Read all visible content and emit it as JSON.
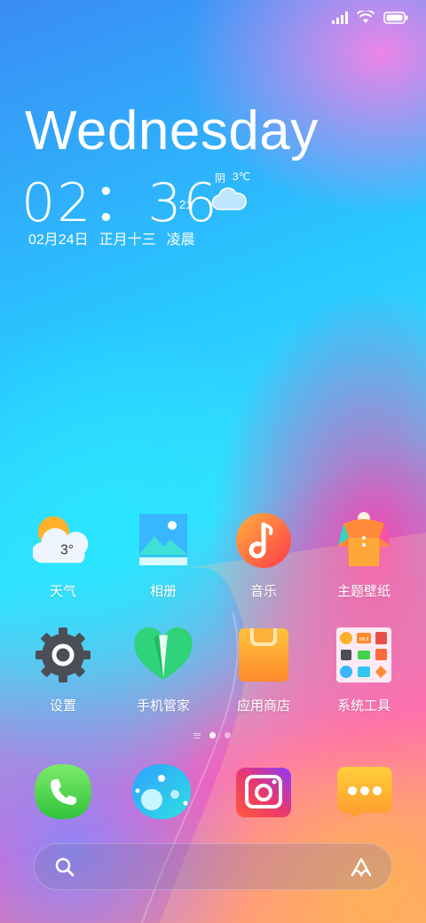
{
  "status_bar": {
    "icons": [
      "signal-icon",
      "wifi-icon",
      "battery-icon"
    ]
  },
  "clock": {
    "day": "Wednesday",
    "time": "02：36",
    "seconds": "21",
    "date": "02月24日",
    "lunar": "正月十三",
    "period": "凌晨"
  },
  "weather": {
    "condition": "阴",
    "temp": "3℃",
    "icon": "cloud-icon"
  },
  "apps": [
    {
      "label": "天气",
      "icon": "weather-icon",
      "badge_text": "3°"
    },
    {
      "label": "相册",
      "icon": "gallery-icon"
    },
    {
      "label": "音乐",
      "icon": "music-icon"
    },
    {
      "label": "主题壁纸",
      "icon": "themes-icon"
    },
    {
      "label": "设置",
      "icon": "settings-icon"
    },
    {
      "label": "手机管家",
      "icon": "security-icon"
    },
    {
      "label": "应用商店",
      "icon": "app-store-icon"
    },
    {
      "label": "系统工具",
      "icon": "tools-folder-icon",
      "folder_badge": "MIUI"
    }
  ],
  "pager": {
    "pages": 2,
    "current": 1
  },
  "dock": [
    {
      "name": "phone",
      "icon": "phone-icon"
    },
    {
      "name": "browser",
      "icon": "browser-icon"
    },
    {
      "name": "camera",
      "icon": "camera-icon"
    },
    {
      "name": "messages",
      "icon": "messages-icon"
    }
  ],
  "search": {
    "left_icon": "search-icon",
    "right_icon": "assistant-icon"
  },
  "colors": {
    "phone": "#3fd34a",
    "music": "#ff6a3c",
    "store": "#ffb03a",
    "messages": "#ffb12e",
    "camera": "#e8386f"
  }
}
